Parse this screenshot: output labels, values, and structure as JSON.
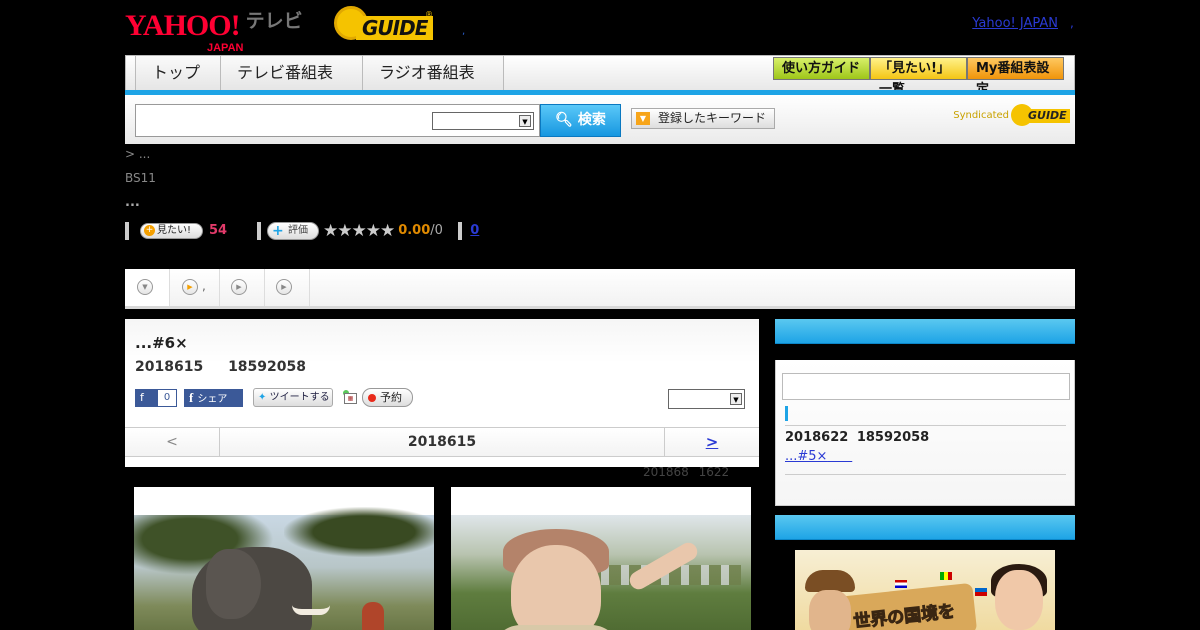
{
  "header": {
    "yahoo_logo": "YAHOO!",
    "yahoo_japan": "JAPAN",
    "tv_label": "テレビ",
    "gguide_logo": "GUIDE",
    "gguide_reg": "®",
    "header_dot": ",",
    "yahoo_japan_link": "Yahoo! JAPAN",
    "header_dot2": ","
  },
  "nav": {
    "tabs": [
      {
        "label": "トップ"
      },
      {
        "label": "テレビ番組表"
      },
      {
        "label": "ラジオ番組表"
      }
    ],
    "right_buttons": [
      {
        "label": "使い方ガイド"
      },
      {
        "label": "「見たい!」一覧"
      },
      {
        "label": "My番組表設定"
      }
    ]
  },
  "search": {
    "value": "",
    "select_value": "",
    "button_label": "検索",
    "keyword_button_label": "登録したキーワード",
    "syndicated_label": "Syndicated",
    "syndicated_logo": "GUIDE"
  },
  "breadcrumb": "> ...",
  "channel": "BS11",
  "meta_dots": "...",
  "meta": {
    "mitai_label": "見たい!",
    "mitai_count": "54",
    "hyoka_label": "評価",
    "stars": "★★★★★",
    "score": "0.00",
    "score_total": "/0",
    "review_count": "0"
  },
  "subtabs": [
    {
      "label": ""
    },
    {
      "label": ","
    },
    {
      "label": ""
    },
    {
      "label": ""
    }
  ],
  "program": {
    "title": "...#6×",
    "date": "2018615 18592058",
    "fb_like_count": "0",
    "fb_share_label": "シェア",
    "tweet_label": "ツイートする",
    "reserve_label": "予約",
    "select_value": ""
  },
  "pager": {
    "prev": "<",
    "current": "2018615",
    "next": ">"
  },
  "pager_note": "201868 1622",
  "right": {
    "next_date": "2018622 18592058",
    "next_link": "...#5×"
  },
  "icons": {
    "search": "magnifier-icon",
    "play": "play-icon"
  },
  "colors": {
    "accent_blue": "#1ea4e6",
    "yahoo_red": "#ff0033",
    "gguide_yellow": "#f5c300",
    "mitai_pink": "#e23a6a",
    "score_orange": "#e08a00",
    "link_blue": "#2a3ad4"
  }
}
